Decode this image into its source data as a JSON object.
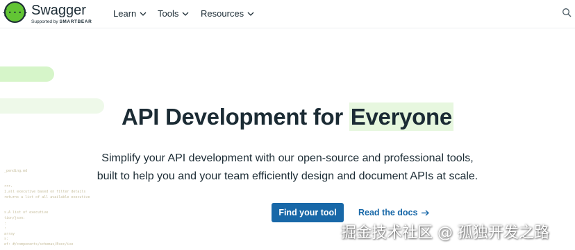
{
  "header": {
    "logo_name": "Swagger",
    "logo_mark": "{···}",
    "supported_by": "Supported by",
    "supported_brand": "SMARTBEAR",
    "nav": [
      {
        "label": "Learn",
        "icon": "chevron-down-icon"
      },
      {
        "label": "Tools",
        "icon": "chevron-down-icon"
      },
      {
        "label": "Resources",
        "icon": "chevron-down-icon"
      }
    ],
    "search_icon": "search-icon"
  },
  "hero": {
    "title_main": "API Development for",
    "title_highlight": "Everyone",
    "subtitle_line1": "Simplify your API development with our open-source and professional tools,",
    "subtitle_line2": "built to help you and your team efficiently design and document APIs at scale.",
    "primary_cta": "Find your tool",
    "secondary_cta": "Read the docs",
    "secondary_icon": "arrow-right-icon"
  },
  "watermark": "掘金技术社区 @ 孤独开发之路",
  "colors": {
    "brand_green": "#62c534",
    "text_dark": "#1b2b34",
    "primary_blue": "#1868a8",
    "highlight": "#e7f7df"
  }
}
